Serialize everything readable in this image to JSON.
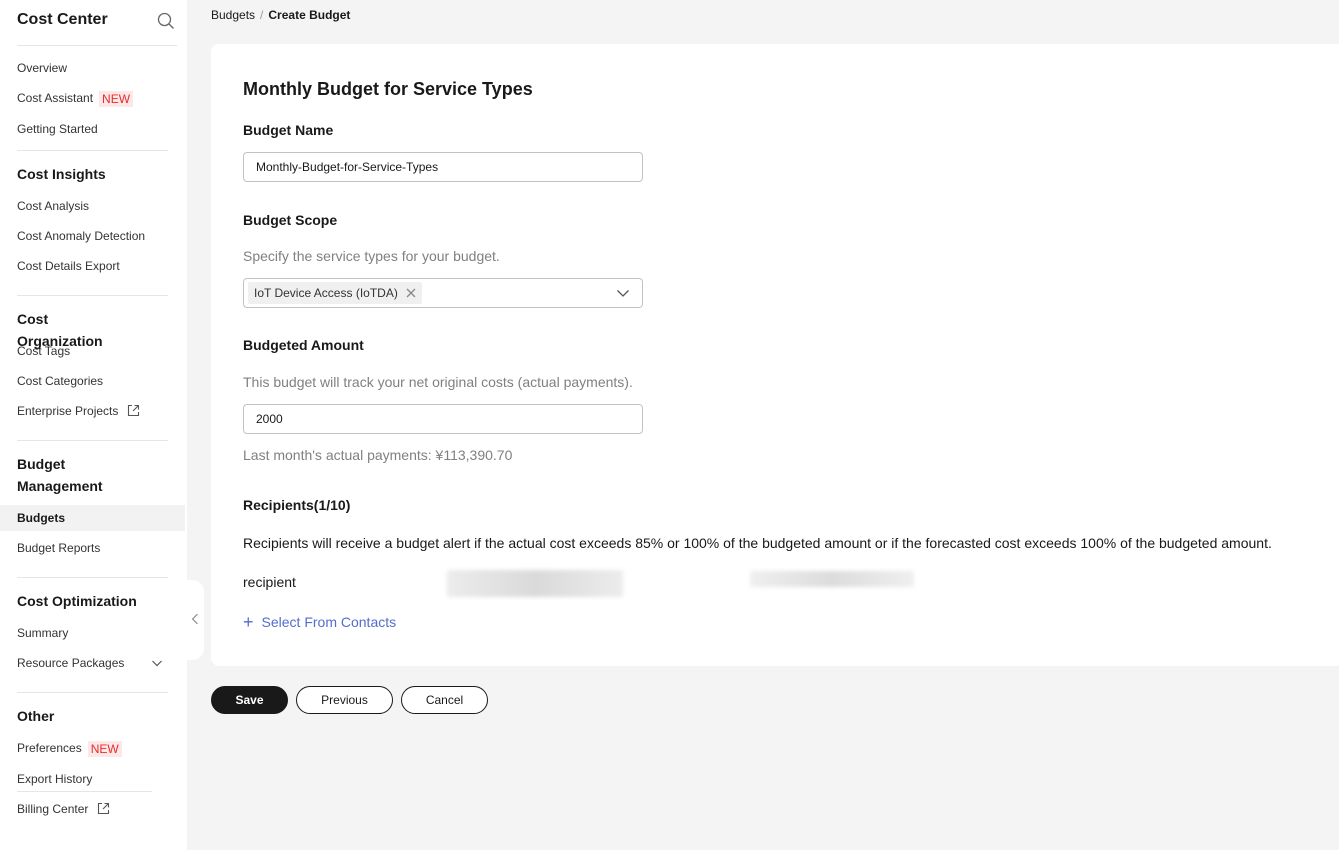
{
  "sidebar": {
    "title": "Cost Center",
    "new_badge": "NEW",
    "top_items": {
      "overview": "Overview",
      "cost_assistant": "Cost Assistant",
      "getting_started": "Getting Started"
    },
    "cost_insights": {
      "title": "Cost Insights",
      "cost_analysis": "Cost Analysis",
      "cost_anomaly_detection": "Cost Anomaly Detection",
      "cost_details_export": "Cost Details Export"
    },
    "cost_organization": {
      "title": "Cost Organization",
      "cost_tags": "Cost Tags",
      "cost_categories": "Cost Categories",
      "enterprise_projects": "Enterprise Projects"
    },
    "budget_management": {
      "title": "Budget Management",
      "budgets": "Budgets",
      "budget_reports": "Budget Reports"
    },
    "cost_optimization": {
      "title": "Cost Optimization",
      "summary": "Summary",
      "resource_packages": "Resource Packages"
    },
    "other": {
      "title": "Other",
      "preferences": "Preferences",
      "export_history": "Export History",
      "billing_center": "Billing Center"
    }
  },
  "breadcrumb": {
    "parent": "Budgets",
    "separator": "/",
    "current": "Create Budget"
  },
  "form": {
    "title": "Monthly Budget for Service Types",
    "budget_name": {
      "label": "Budget Name",
      "value": "Monthly-Budget-for-Service-Types"
    },
    "budget_scope": {
      "label": "Budget Scope",
      "hint": "Specify the service types for your budget.",
      "selected_tag": "IoT Device Access (IoTDA)"
    },
    "budgeted_amount": {
      "label": "Budgeted Amount",
      "hint": "This budget will track your net original costs (actual payments).",
      "value": "2000",
      "last_month": "Last month's actual payments: ¥113,390.70"
    },
    "recipients": {
      "label": "Recipients(1/10)",
      "description": "Recipients will receive a budget alert if the actual cost exceeds 85% or 100% of the budgeted amount or if the forecasted cost exceeds 100% of the budgeted amount.",
      "recipient_name": "recipient",
      "add_link": "Select From Contacts"
    }
  },
  "footer": {
    "save": "Save",
    "previous": "Previous",
    "cancel": "Cancel"
  },
  "colors": {
    "accent_link": "#526ecc",
    "new_badge_bg": "#fde7e7",
    "new_badge_text": "#e62e2e",
    "primary_button": "#191919"
  }
}
